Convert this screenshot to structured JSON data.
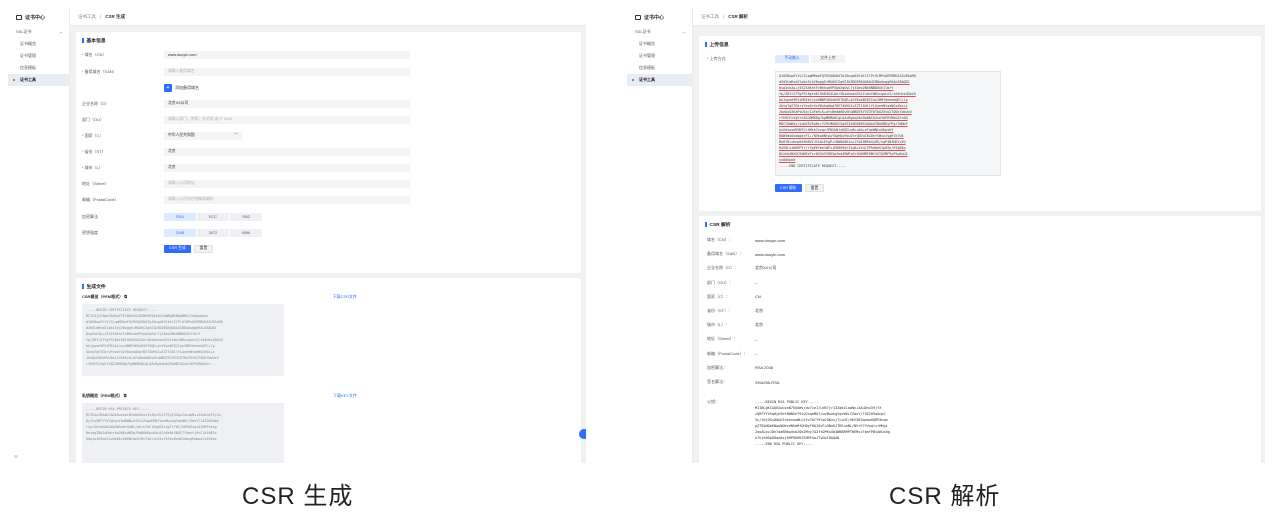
{
  "left_panel": {
    "app_title": "证书中心",
    "menu": {
      "group": "SSL证书",
      "items": [
        "证书概览",
        "证书管理",
        "信息模板",
        "证书工具"
      ],
      "active": "证书工具"
    },
    "breadcrumb": {
      "parent": "证书工具",
      "current": "CSR 生成"
    },
    "basic_info": {
      "title": "基本信息",
      "cn_label": "域名（CN）",
      "cn_value": "www.douyin.com",
      "san_label": "备用域名（SAN）",
      "san_placeholder": "请输入备用域名",
      "add_san_label": "添加备用域名",
      "org_label": "企业名称（O）",
      "org_value": "北京XX公司",
      "ou_label": "部门（OU）",
      "ou_placeholder": "请输入部门，例如：技术部 或 IT Dept",
      "country_label": "国家（C）",
      "country_value": "中华人民共和国",
      "state_label": "省份（ST）",
      "state_value": "北京",
      "city_label": "城市（L）",
      "city_value": "北京",
      "street_label": "地址（Street）",
      "street_placeholder": "请输入公司地址",
      "postal_label": "邮编（PostalCode）",
      "postal_placeholder": "请输入公司所在地邮政编码",
      "algo_label": "加密算法",
      "algo_options": [
        "RSA",
        "ECC",
        "SM2"
      ],
      "algo_selected": "RSA",
      "keylen_label": "密钥强度",
      "keylen_options": [
        "2048",
        "3072",
        "4096"
      ],
      "keylen_selected": "2048",
      "generate_button": "CSR 生成",
      "reset_button": "重置"
    },
    "output": {
      "title": "生成文件",
      "csr_label": "CSR概览（PEM格式）",
      "csr_download": "下载CSR文件",
      "csr_text": [
        "-----BEGIN CERTIFICATE REQUEST-----",
        "MIIC0jCCAboCAQAwYTELMAkGA1UEBhMCQ04xDzANBgNVBAgMBkJlaUppbmcx",
        "A1UEBwwGYiVlJLqqMRowFQYDVQQKDA7bJ8uqaE0lbtlIlPrOlMPuOEEMBUSA1UEAxMO",
        "d3d3LmRvdXlpbi5jb20wggEiMA0GCSqGSIb3DQEBAQUAA4IBDwAwggEKAoIBAQDC",
        "8sg3xkZp+j5SJXXKhtFvBhhum9PXpbXqOvL7j4OeoZNeUNBDUXhIlbrY",
        "fp/ZKYr2TYgF9l8pfe6lHhD3G4CAerZbsehmsdSSiIndxCW8vcgwLnS/zA4UxsXDoVG",
        "bk1ypee9EViMS5kiJysUNBP4KUoKXKTUQR+4nYKoaBIDCIay2BMfdeeebQEC+lp",
        "4AtqTgGTGkryYeoOrXvV8ukqAbg76ET4WYk2+EZTtGdllfLAyeeNtaeNGzXbc+z",
        "JkeQuUXKaPsUSa/14Fm9+K+dfxBedd6DvEhuNBDTKYVZ3T6TbOZ5tb2TQOk7bbUzU",
        "rYh9CFcVgVrhIDJDMKDg7kgM6MA8CgLQAcBgkqhkG9w0BCQ4xeYAFMlMkGAYc..."
      ],
      "key_label": "私钥概览（PEM格式）",
      "key_download": "下载KEY文件",
      "key_text": [
        "-----BEGIN RSA PRIVATE KEY-----",
        "MIIEowIBAAKCAQEAweowtNVa0aSkvvfvZgc5LJtFSyI3ZqzIzLapNv+4AuDns5fyJo",
        "8yfvuQRFYYVSqGyvfbd8WN+e19i2ZsqwKMQfvovBwukgYqcW6LYZmuY/l4Z205OmA",
        "rspiIOc0kOOu0qUbOvmrUwNL/qEiu7bC19qQOtcupTc*HC/hKVQ5uq+OJHRProsg",
        "RnsagZDbIwDdnrkwD0KudN5mJ9mN8HOpuUkUj5u0sNc3NGITYUmvtj9cC/bIdBSx",
        "HdgJwIO3mcGxcNsBkzhNUNCqe5tMvTsU+lnQ1vfLRhv0eaD1dmvgKmbpA/s4V4mv"
      ]
    },
    "caption": "CSR 生成"
  },
  "right_panel": {
    "app_title": "证书中心",
    "menu": {
      "group": "SSL证书",
      "items": [
        "证书概览",
        "证书管理",
        "信息模板",
        "证书工具"
      ],
      "active": "证书工具"
    },
    "breadcrumb": {
      "parent": "证书工具",
      "current": "CSR 解析"
    },
    "upload": {
      "title": "上传信息",
      "method_label": "上传方式",
      "tabs": [
        "手动输入",
        "文件上传"
      ],
      "tab_selected": "手动输入",
      "csr_text": [
        "A1UEBwwGYiVlJLqqMRowFQYDVQQKDA7bJ8uqaE0lbtlIlPrOlMPuOEEMBUSA1UEAxMO",
        "d3d3LmRvdXlpbi5jb20wggEiMA0GCSqGSIb3DQEBAQUAA4IBDwAwggEKAoIBAQDC",
        "8sg3xkZp+j5SJXXKhtFvBhhum9PXpbXqOvL7j4OeoZNeUNBDUXhIlbrY",
        "fp/ZKYr2TYgF9l8pfe6lHhD3G4CAerZbsehmsdSSiIndxCW8vcgwLnS/zA4UxsXDoVG",
        "bk1ypee9EViMS5kiJysUNBP4KUoKXKTUQR+4nYKoaBIDCIay2BMfdeeebQEC+lp",
        "4AtqTgGTGkryYeoOrXvV8ukqAbg76ET4WYk2+EZTtGdllfLAyeeNtaeNGzXbc+z",
        "JkeQuUXKaPsUSa/14Fm9+K+dfxBedd6DvEhuNBDTKYVZ3T6TbOZ5tb2TQOk7bbUzU",
        "rYh9CFcVgVrhIDJDMKDg7kgM6MA8CgLQAcBgkqhkG9w0BCQ4xeYAFMlMkGAYc0Q",
        "MBCCDmDdyliwb2EVSwNLrY29tMA0GCSqGSIb3DQEBCwUAA4IBAQBDyFPgr7WOmf",
        "auXdsoxeDVKP/LhMsk7xzqcJPDSkNlyKQCLm8+nA4+eTqeWNLnUKpsHt",
        "R8W3mxOsdqqkrF1+/N5kwbNtpuYGgHQcHVwJhrQDVuC0iDhfSWsxJsgHlk7Ok",
        "BuHlM+vbnp0e9hNVIJYkAiEtgP+rNW0A8Kin+JYbI0M5kXy8E/ugP4NfHOYz5Q",
        "R4VOLvzD0EPIr/rYgEK7me1WFs+ED8U9d/Ziq6+Ie4/ZPhdOeSJpHXn/8TqBIp",
        "BSvhUAN2OC9aREeTcr0SSnV3965p3ed4RWFq3rGH4MMIRBt5XTA5MF9yPSw6uUI",
        "vn8dSpnH",
        "-----END CERTIFICATE REQUEST-----"
      ],
      "parse_button": "CSR 解析",
      "reset_button": "重置"
    },
    "result": {
      "title": "CSR 解析",
      "rows": [
        {
          "label": "域名（CN）：",
          "value": "www.douyin.com"
        },
        {
          "label": "备用域名（SAN）：",
          "value": "www.douyin.com"
        },
        {
          "label": "企业名称（O）：",
          "value": "北京XX公司"
        },
        {
          "label": "部门（OU）：",
          "value": "--"
        },
        {
          "label": "国家（C）：",
          "value": "CN"
        },
        {
          "label": "省份（ST）：",
          "value": "北京"
        },
        {
          "label": "城市（L）：",
          "value": "北京"
        },
        {
          "label": "地址（Street）：",
          "value": "--"
        },
        {
          "label": "邮编（PostalCode）：",
          "value": "--"
        },
        {
          "label": "加密算法：",
          "value": "RSA 2048"
        },
        {
          "label": "签名算法：",
          "value": "SHA256-RSA"
        }
      ],
      "pubkey_label": "公钥：",
      "pubkey_text": [
        "-----BEGIN RSA PUBLIC KEY-----",
        "MIIBCgKCAQEAwuvoN75QaWv/dv7ieI/LdR7jrI3ZqbZLapNy+4AuDns59jfX",
        "zQRFYYVSq0yh9bf8WN5eY9iQ2xqaMQf/wvBwukgYqcW6LYZmuY/l9Z205mAnpC",
        "5c/tOjDSs0OpU3rmhshaWLUjEu7bCY9lqC0KvsjTc+HC/hKV3D3qoqnOQRPAnqe",
        "gZTEkNQbKNwuNOKvdN5mMfQHOyFHAJQvFu3NxKJTRE+mNL/NVrE7YUnqlzrMHgL",
        "ZaoACpvJDh7aaBBbwdsb2Qb2Mny7A2ftQPKsUb4WB8RMPTWVMxifkmfPBvAKUx0g",
        "n7kjk0DpO8ao0xj0HPGKHDZSHRFAaJTvOwIDAQAB",
        "-----END RSA PUBLIC KEY-----"
      ]
    },
    "caption": "CSR 解析"
  }
}
